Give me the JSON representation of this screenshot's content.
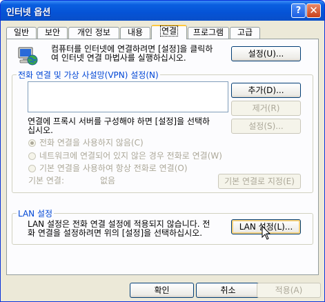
{
  "window": {
    "title": "인터넷 옵션",
    "help_label": "?",
    "close_label": "✕"
  },
  "tabs": [
    "일반",
    "보안",
    "개인 정보",
    "내용",
    "연결",
    "프로그램",
    "고급"
  ],
  "active_tab": "연결",
  "setup": {
    "text_line1": "컴퓨터를 인터넷에 연결하려면 [설정]을 클릭하",
    "text_line2": "여 인터넷 연결 마법사를 실행하십시오.",
    "button": "설정(U)..."
  },
  "dialup": {
    "legend": "전화 연결 및 가상 사설망(VPN) 설정(N)",
    "add_button": "추가(D)...",
    "remove_button": "제거(R)",
    "settings_button": "설정(S)...",
    "proxy_text_line1": "연결에 프록시 서버를 구성해야 하면 [설정]을 선택하",
    "proxy_text_line2": "십시오.",
    "radio_never": "전화 연결을 사용하지 않음(C)",
    "radio_when_no_network": "네트워크에 연결되어 있지 않은 경우 전화로 연결(W)",
    "radio_always": "기본 연결을 사용하여 항상 전화로 연결(O)",
    "default_label": "기본 연결:",
    "default_value": "없음",
    "set_default_button": "기본 연결로 지정(E)"
  },
  "lan": {
    "legend": "LAN 설정",
    "text_line1": "LAN 설정은 전화 연결 설정에 적용되지 않습니다. 전",
    "text_line2": "화 연결을 설정하려면 위의 [설정]을 선택하십시오.",
    "button": "LAN 설정(L)..."
  },
  "footer": {
    "ok": "확인",
    "cancel": "취소",
    "apply": "적용(A)"
  }
}
